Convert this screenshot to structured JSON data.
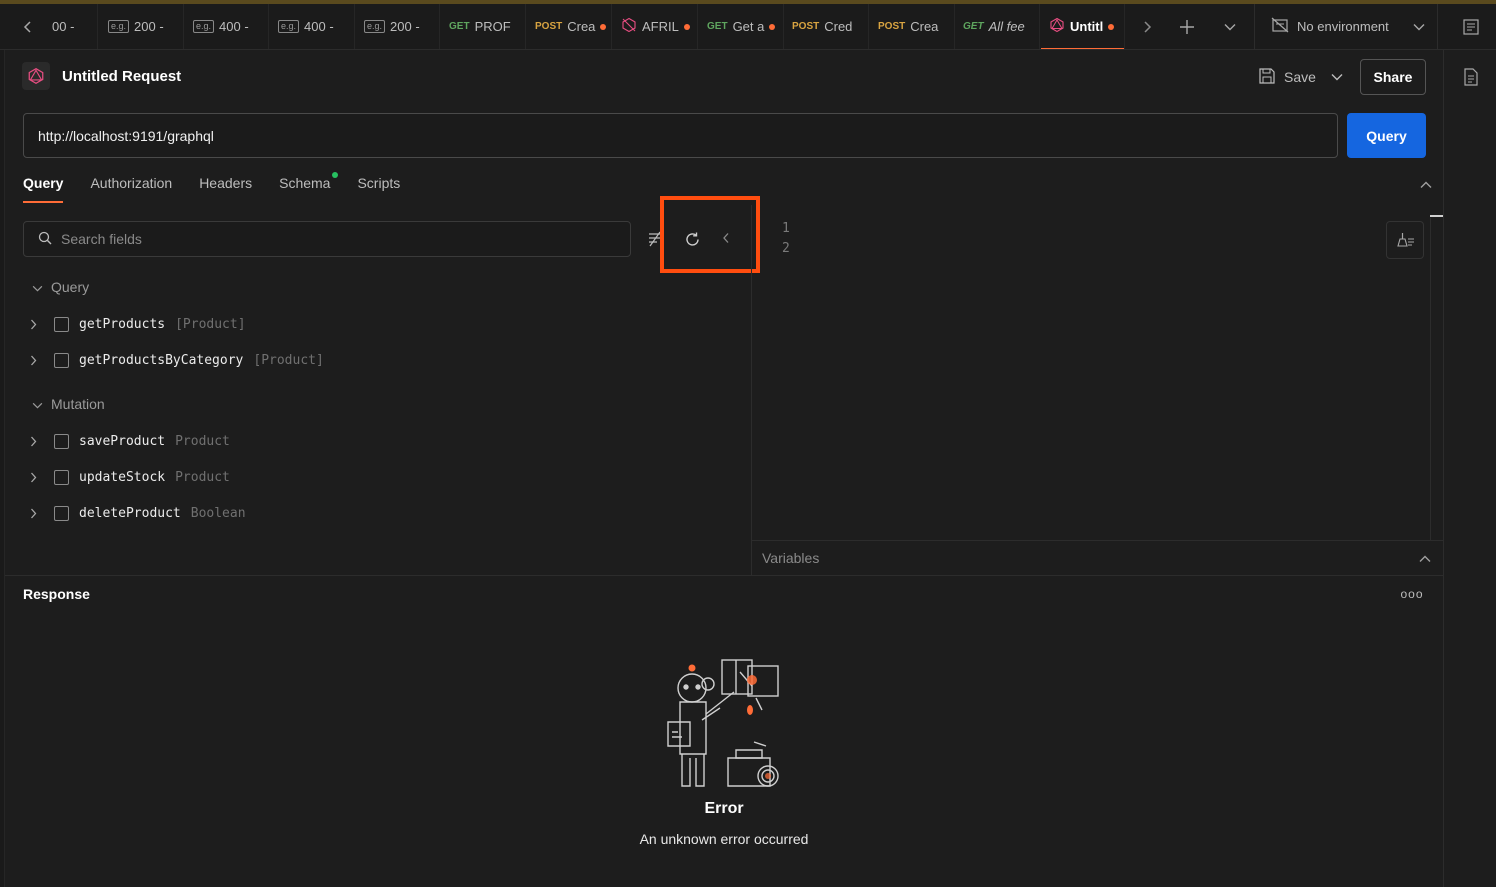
{
  "window": {
    "accent": "#ff6c37",
    "primary": "#1566e0"
  },
  "tabs": [
    {
      "method": "",
      "label": "00 -",
      "eg": false,
      "dot": false
    },
    {
      "method": "",
      "label": "200 -",
      "eg": true,
      "dot": false
    },
    {
      "method": "",
      "label": "400 -",
      "eg": true,
      "dot": false
    },
    {
      "method": "",
      "label": "400 -",
      "eg": true,
      "dot": false
    },
    {
      "method": "",
      "label": "200 -",
      "eg": true,
      "dot": false
    },
    {
      "method": "GET",
      "label": "PROF",
      "eg": false,
      "dot": false
    },
    {
      "method": "POST",
      "label": "Crea",
      "eg": false,
      "dot": true
    },
    {
      "method": "",
      "label": "AFRIL",
      "eg": false,
      "dot": true,
      "icon": "graphql-slash-icon"
    },
    {
      "method": "GET",
      "label": "Get a",
      "eg": false,
      "dot": true
    },
    {
      "method": "POST",
      "label": "Cred",
      "eg": false,
      "dot": false
    },
    {
      "method": "POST",
      "label": "Crea",
      "eg": false,
      "dot": false
    },
    {
      "method": "GET",
      "label": "All fee",
      "eg": false,
      "dot": false,
      "italic": true
    },
    {
      "method": "",
      "label": "Untitl",
      "eg": false,
      "dot": true,
      "icon": "graphql-icon",
      "active": true
    }
  ],
  "environment": {
    "label": "No environment"
  },
  "request": {
    "title": "Untitled Request",
    "save_label": "Save",
    "share_label": "Share",
    "url": "http://localhost:9191/graphql",
    "send_label": "Query"
  },
  "subtabs": [
    "Query",
    "Authorization",
    "Headers",
    "Schema",
    "Scripts"
  ],
  "search": {
    "placeholder": "Search fields"
  },
  "schema": {
    "query_section": "Query",
    "mutation_section": "Mutation",
    "queries": [
      {
        "name": "getProducts",
        "type": "[Product]"
      },
      {
        "name": "getProductsByCategory",
        "type": "[Product]"
      }
    ],
    "mutations": [
      {
        "name": "saveProduct",
        "type": "Product"
      },
      {
        "name": "updateStock",
        "type": "Product"
      },
      {
        "name": "deleteProduct",
        "type": "Boolean"
      }
    ]
  },
  "editor": {
    "line_numbers": [
      "1",
      "2"
    ]
  },
  "variables": {
    "label": "Variables"
  },
  "response": {
    "title": "Response",
    "more": "ooo",
    "error_title": "Error",
    "error_message": "An unknown error occurred"
  }
}
